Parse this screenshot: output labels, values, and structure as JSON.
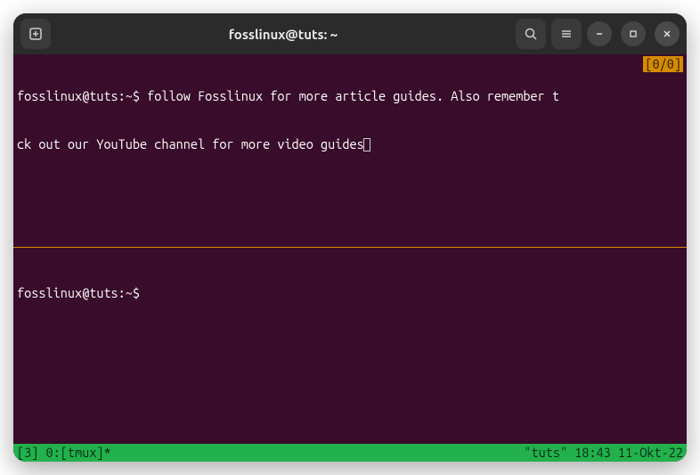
{
  "titlebar": {
    "title": "fosslinux@tuts: ~"
  },
  "pane_top": {
    "prompt": "fosslinux@tuts:~$",
    "line1_cmd": " follow Fosslinux for more article guides. Also remember t",
    "line2": "ck out our YouTube channel for more video guides",
    "search_indicator": "[0/0]"
  },
  "pane_bottom": {
    "prompt": "fosslinux@tuts:~$"
  },
  "status": {
    "left": "[3] 0:[tmux]*",
    "right": "\"tuts\" 18:43 11-Okt-22"
  }
}
